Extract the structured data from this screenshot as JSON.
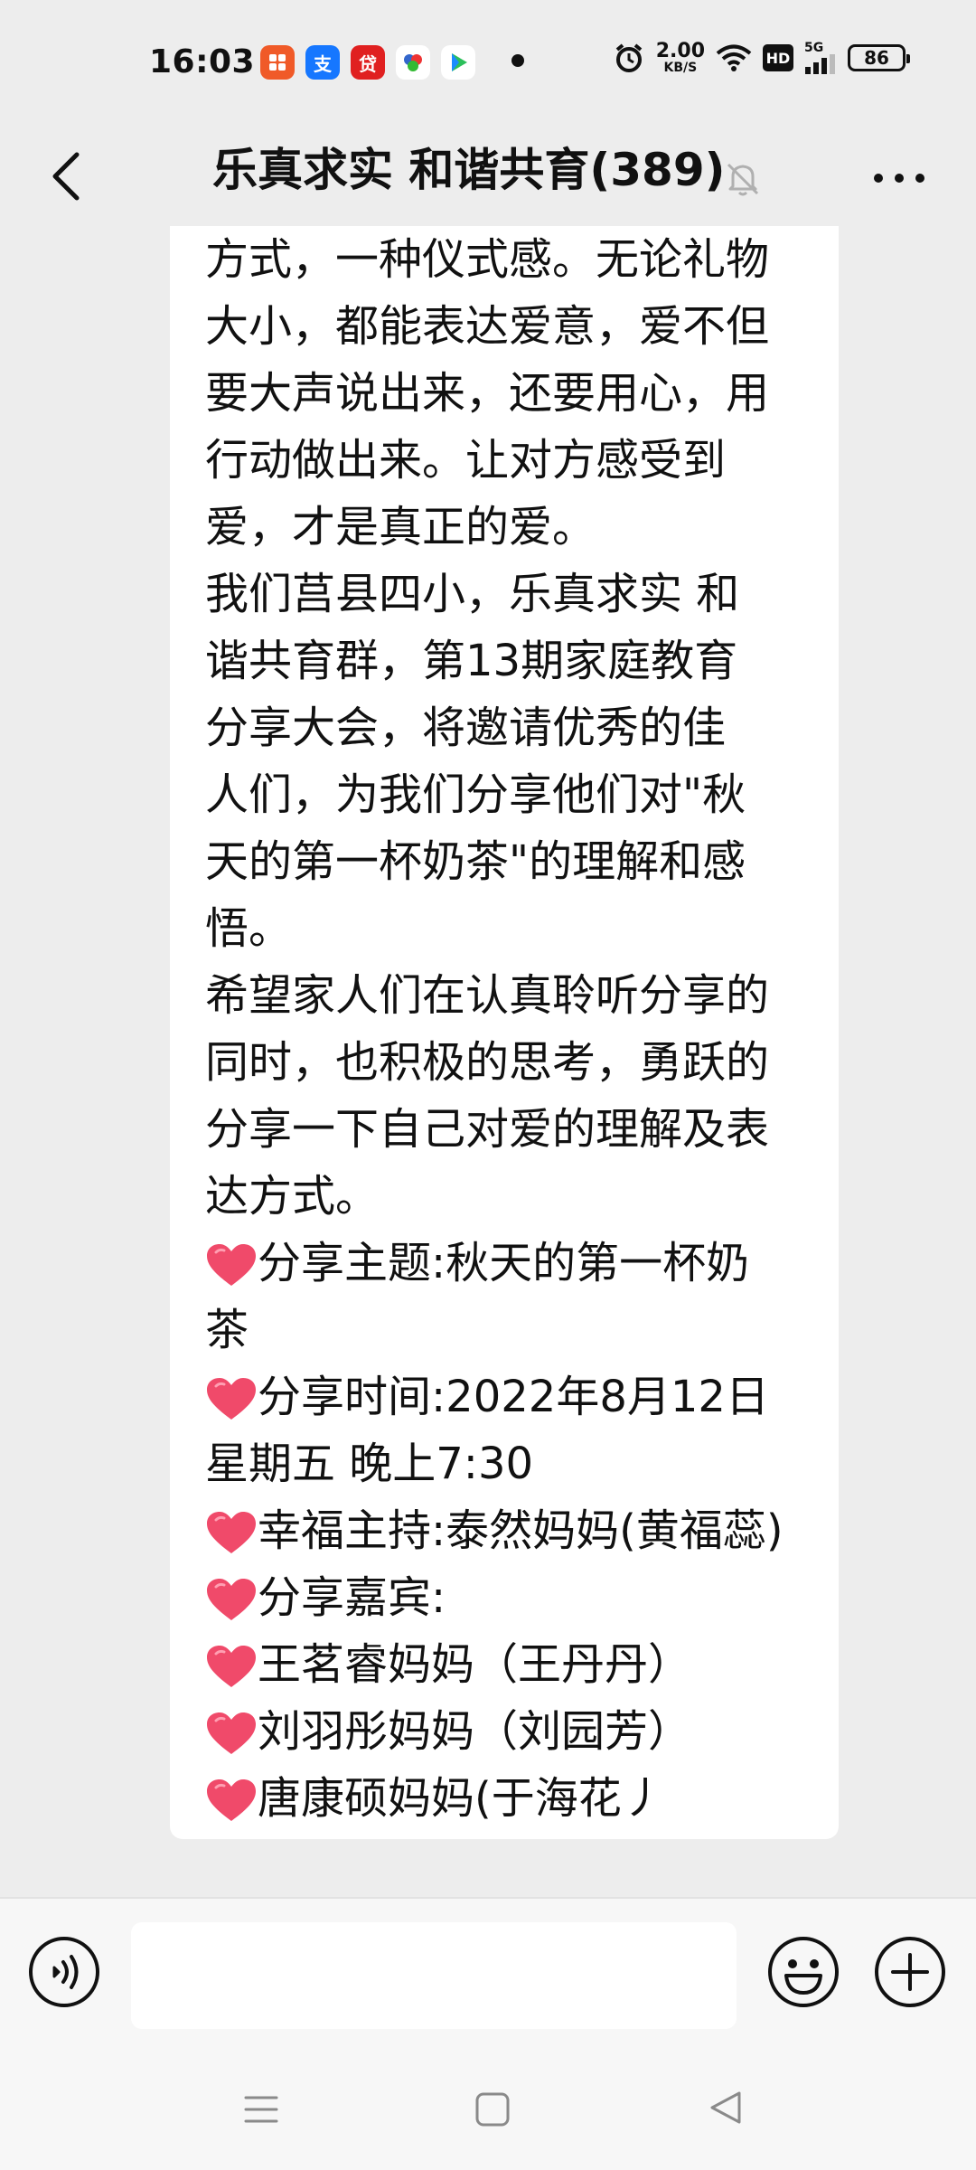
{
  "status_bar": {
    "time": "16:03",
    "net_speed_value": "2.00",
    "net_speed_unit": "KB/S",
    "hd": "HD",
    "signal": "5G",
    "battery": "86",
    "app_icons": [
      {
        "label": "",
        "color": "#f05a28"
      },
      {
        "label": "支",
        "color": "#1677ff"
      },
      {
        "label": "贷",
        "color": "#e02020"
      },
      {
        "label": "",
        "color": "#ffffff"
      },
      {
        "label": "",
        "color": "#ffffff"
      }
    ]
  },
  "header": {
    "title": "乐真求实 和谐共育(389)"
  },
  "message": {
    "lines": [
      "方式，一种仪式感。无论礼物",
      "大小，都能表达爱意，爱不但",
      "要大声说出来，还要用心，用",
      "行动做出来。让对方感受到",
      "爱，才是真正的爱。",
      " 我们莒县四小，乐真求实  和",
      "谐共育群，第13期家庭教育",
      "分享大会，将邀请优秀的佳",
      "人们，为我们分享他们对\"秋",
      "天的第一杯奶茶\"的理解和感",
      "悟。",
      "希望家人们在认真聆听分享的",
      "同时，也积极的思考，勇跃的",
      "分享一下自己对爱的理解及表",
      "达方式。"
    ],
    "heart_lines": [
      {
        "text": "分享主题:秋天的第一杯奶",
        "heart": true
      },
      {
        "text": "茶",
        "heart": false
      },
      {
        "text": "分享时间:2022年8月12日",
        "heart": true
      },
      {
        "text": "星期五 晚上7:30",
        "heart": false
      },
      {
        "text": "幸福主持:泰然妈妈(黄福蕊)",
        "heart": true
      },
      {
        "text": "分享嘉宾:",
        "heart": true
      },
      {
        "text": "王茗睿妈妈（王丹丹）",
        "heart": true
      },
      {
        "text": "刘羽彤妈妈（刘园芳）",
        "heart": true
      },
      {
        "text": "唐康硕妈妈(于海花丿",
        "heart": true
      }
    ]
  },
  "input": {
    "value": "",
    "placeholder": ""
  },
  "colors": {
    "background": "#ededed",
    "bubble": "#ffffff",
    "heart": "#f04a6a",
    "input_bar": "#f7f7f7"
  }
}
